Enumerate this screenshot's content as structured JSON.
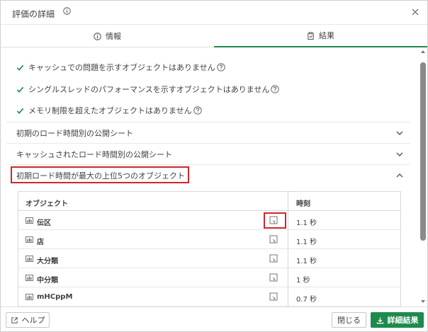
{
  "dialog": {
    "title": "評価の詳細",
    "close_icon": "close-icon",
    "info_icon": "info-icon"
  },
  "tabs": [
    {
      "label": "情報",
      "icon": "info-icon",
      "active": false
    },
    {
      "label": "結果",
      "icon": "clipboard-icon",
      "active": true
    }
  ],
  "checks": [
    {
      "text": "キャッシュでの問題を示すオブジェクトはありません"
    },
    {
      "text": "シングルスレッドのパフォーマンスを示すオブジェクトはありません"
    },
    {
      "text": "メモリ制限を超えたオブジェクトはありません"
    }
  ],
  "sections": [
    {
      "label": "初期のロード時間別の公開シート",
      "expanded": false
    },
    {
      "label": "キャッシュされたロード時間別の公開シート",
      "expanded": false
    },
    {
      "label": "初期ロード時間が最大の上位5つのオブジェクト",
      "expanded": true
    }
  ],
  "table": {
    "headers": {
      "object": "オブジェクト",
      "time": "時刻"
    },
    "rows": [
      {
        "name": "伝区",
        "time": "1.1 秒"
      },
      {
        "name": "店",
        "time": "1.1 秒"
      },
      {
        "name": "大分類",
        "time": "1.1 秒"
      },
      {
        "name": "中分類",
        "time": "1 秒"
      },
      {
        "name": "mHCppM",
        "time": "0.7 秒"
      }
    ]
  },
  "footer": {
    "help_label": "ヘルプ",
    "close_label": "閉じる",
    "export_label": "詳細結果"
  },
  "colors": {
    "accent": "#1e8a4c",
    "highlight": "#d0262d"
  }
}
